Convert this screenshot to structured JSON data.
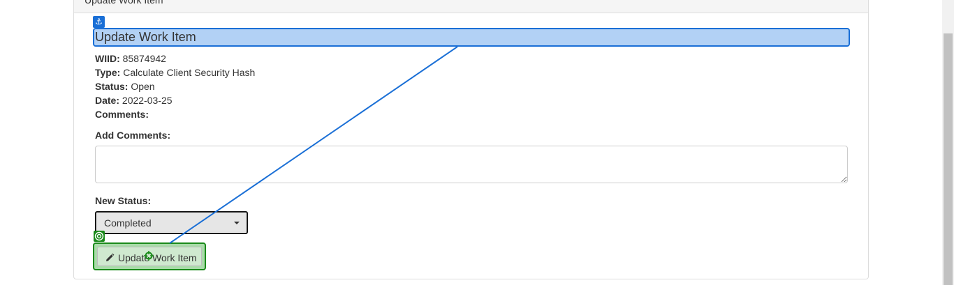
{
  "panel": {
    "heading": "Update Work Item"
  },
  "form": {
    "title": "Update Work Item",
    "wiid": {
      "label": "WIID:",
      "value": "85874942"
    },
    "type": {
      "label": "Type:",
      "value": "Calculate Client Security Hash"
    },
    "status": {
      "label": "Status:",
      "value": "Open"
    },
    "date": {
      "label": "Date:",
      "value": "2022-03-25"
    },
    "comments": {
      "label": "Comments:",
      "value": ""
    },
    "add_comments": {
      "label": "Add Comments:",
      "value": ""
    },
    "new_status": {
      "label": "New Status:",
      "selected": "Completed"
    },
    "submit_label": "Update Work Item"
  },
  "overlay": {
    "anchor_icon": "anchor-icon",
    "target_icon": "target-icon",
    "anchor_color": "#1a6fd6",
    "target_color": "#1a8a1a"
  }
}
